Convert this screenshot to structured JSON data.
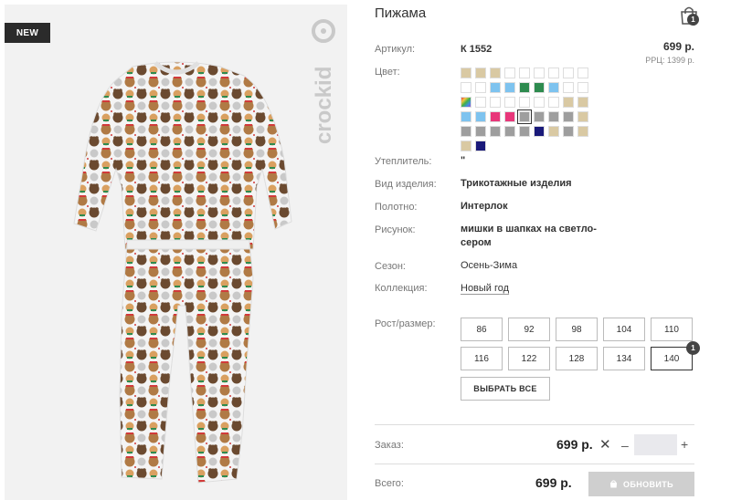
{
  "product": {
    "badge": "NEW",
    "brand": "crockid",
    "title": "Пижама"
  },
  "cart": {
    "icon": "shopping-bag-icon",
    "count": "1"
  },
  "details": {
    "article_label": "Артикул:",
    "article_value": "К 1552",
    "price": "699 р.",
    "rrc": "РРЦ: 1399 р.",
    "color_label": "Цвет:",
    "insulation_label": "Утеплитель:",
    "insulation_value": "\"",
    "type_label": "Вид изделия:",
    "type_value": "Трикотажные изделия",
    "fabric_label": "Полотно:",
    "fabric_value": "Интерлок",
    "pattern_label": "Рисунок:",
    "pattern_value": "мишки в шапках на светло-сером",
    "season_label": "Сезон:",
    "season_value": "Осень-Зима",
    "collection_label": "Коллекция:",
    "collection_value": "Новый год"
  },
  "colors": {
    "swatches": [
      "#d9c9a3",
      "#d9c9a3",
      "#d9c9a3",
      "#ffffff",
      "#ffffff",
      "#ffffff",
      "#ffffff",
      "#ffffff",
      "#ffffff",
      "#ffffff",
      "#ffffff",
      "#7ec3ef",
      "#7ec3ef",
      "#2e8b4f",
      "#2e8b4f",
      "#7ec3ef",
      "#ffffff",
      "#ffffff",
      "#rainbow",
      "#ffffff",
      "#ffffff",
      "#ffffff",
      "#ffffff",
      "#ffffff",
      "#ffffff",
      "#d9c9a3",
      "#d9c9a3",
      "#7ec3ef",
      "#7ec3ef",
      "#e8377a",
      "#e8377a",
      "#9e9e9e",
      "#9e9e9e",
      "#9e9e9e",
      "#9e9e9e",
      "#d9c9a3",
      "#9e9e9e",
      "#9e9e9e",
      "#9e9e9e",
      "#9e9e9e",
      "#9e9e9e",
      "#1a1a7a",
      "#d9c9a3",
      "#9e9e9e",
      "#d9c9a3",
      "#d9c9a3",
      "#1a1a7a"
    ],
    "selected_index": 31
  },
  "sizes": {
    "label": "Рост/размер:",
    "options": [
      "86",
      "92",
      "98",
      "104",
      "110",
      "116",
      "122",
      "128",
      "134",
      "140"
    ],
    "active_index": 9,
    "active_count": "1",
    "select_all": "ВЫБРАТЬ ВСЕ"
  },
  "order": {
    "label": "Заказ:",
    "price": "699 р.",
    "times": "✕",
    "minus": "–",
    "plus": "+",
    "quantity": ""
  },
  "total": {
    "label": "Всего:",
    "price": "699 р.",
    "update_button": "ОБНОВИТЬ"
  }
}
